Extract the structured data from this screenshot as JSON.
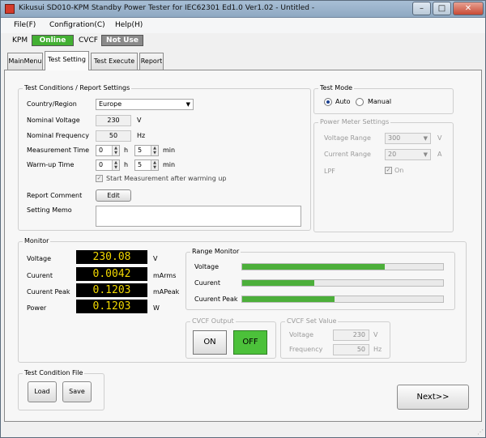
{
  "window": {
    "title": "Kikusui SD010-KPM Standby Power Tester for IEC62301 Ed1.0 Ver1.02 - Untitled -",
    "minimize": "–",
    "maximize": "□",
    "close": "✕"
  },
  "menu": [
    "File(F)",
    "Configration(C)",
    "Help(H)"
  ],
  "status": {
    "kpm_label": "KPM",
    "kpm_value": "Online",
    "kpm_color": "#43b033",
    "cvcf_label": "CVCF",
    "cvcf_value": "Not Use",
    "cvcf_color": "#8a8a8a"
  },
  "tabs": [
    "MainMenu",
    "Test Setting",
    "Test Execute",
    "Report"
  ],
  "active_tab": "Test Setting",
  "test_conditions": {
    "title": "Test Conditions / Report Settings",
    "country_label": "Country/Region",
    "country_value": "Europe",
    "voltage_label": "Nominal Voltage",
    "voltage_value": "230",
    "voltage_unit": "V",
    "freq_label": "Nominal Frequency",
    "freq_value": "50",
    "freq_unit": "Hz",
    "meas_label": "Measurement Time",
    "meas_h": "0",
    "meas_h_unit": "h",
    "meas_min": "5",
    "meas_min_unit": "min",
    "warm_label": "Warm-up Time",
    "warm_h": "0",
    "warm_h_unit": "h",
    "warm_min": "5",
    "warm_min_unit": "min",
    "start_after_warm": "Start Measurement after warming up",
    "comment_label": "Report Comment",
    "edit_button": "Edit",
    "memo_label": "Setting Memo"
  },
  "test_mode": {
    "title": "Test Mode",
    "options": [
      "Auto",
      "Manual"
    ],
    "selected": "Auto"
  },
  "power_meter": {
    "title": "Power Meter Settings",
    "voltage_range_label": "Voltage Range",
    "voltage_range_value": "300",
    "voltage_range_unit": "V",
    "current_range_label": "Current Range",
    "current_range_value": "20",
    "current_range_unit": "A",
    "lpf_label": "LPF",
    "lpf_value": "On"
  },
  "monitor": {
    "title": "Monitor",
    "readings": [
      {
        "label": "Voltage",
        "value": "230.08",
        "unit": "V"
      },
      {
        "label": "Cuurent",
        "value": "0.0042",
        "unit": "mArms"
      },
      {
        "label": "Cuurent Peak",
        "value": "0.1203",
        "unit": "mAPeak"
      },
      {
        "label": "Power",
        "value": "0.1203",
        "unit": "W"
      }
    ],
    "range_title": "Range Monitor",
    "range": [
      {
        "label": "Voltage",
        "fraction": 0.71
      },
      {
        "label": "Cuurent",
        "fraction": 0.36
      },
      {
        "label": "Cuurent Peak",
        "fraction": 0.46
      }
    ],
    "range_color": "#4caf3a"
  },
  "cvcf_output": {
    "title": "CVCF Output",
    "on_label": "ON",
    "off_label": "OFF",
    "active": "OFF",
    "active_color": "#4cc13a"
  },
  "cvcf_set": {
    "title": "CVCF Set Value",
    "voltage_label": "Voltage",
    "voltage_value": "230",
    "voltage_unit": "V",
    "freq_label": "Frequency",
    "freq_value": "50",
    "freq_unit": "Hz"
  },
  "file": {
    "title": "Test Condition File",
    "load": "Load",
    "save": "Save"
  },
  "next_button": "Next>>"
}
